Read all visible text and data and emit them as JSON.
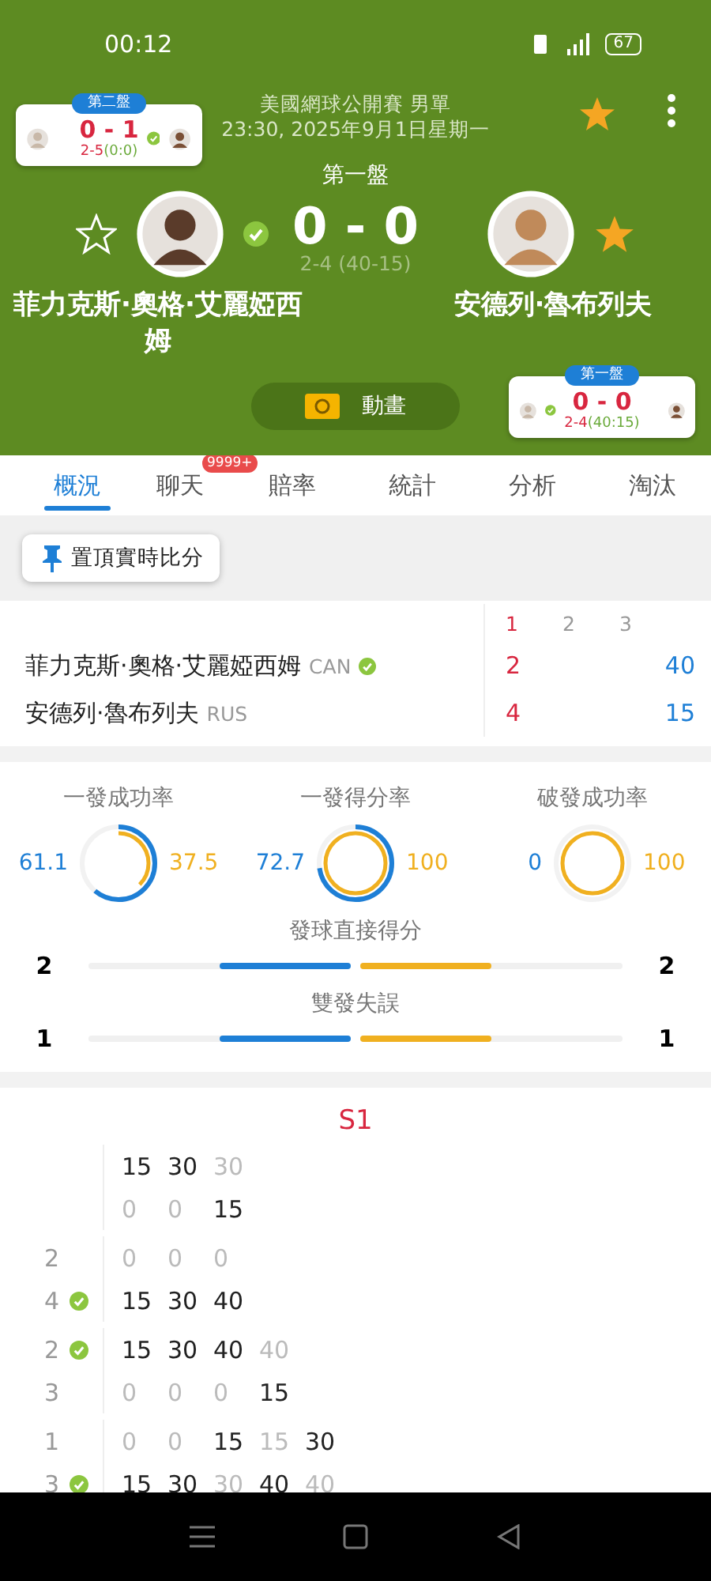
{
  "status_bar": {
    "time": "00:12",
    "battery": "67"
  },
  "header": {
    "title": "美國網球公開賽 男單",
    "datetime": "23:30, 2025年9月1日星期一",
    "favorite": true
  },
  "match": {
    "set_label": "第一盤",
    "score": "0 - 0",
    "sub_score": "2-4 (40-15)",
    "animation_button": "動畫",
    "players": [
      {
        "name": "菲力克斯·奧格·艾麗婭西姆",
        "favorite": false,
        "serving": true
      },
      {
        "name": "安德列·魯布列夫",
        "favorite": true,
        "serving": false
      }
    ]
  },
  "mini_cards": [
    {
      "badge": "第二盤",
      "score": "0 - 1",
      "games": "2-5",
      "points": "(0:0)",
      "left_serving": false,
      "right_serving": true
    },
    {
      "badge": "第一盤",
      "score": "0 - 0",
      "games": "2-4",
      "points": "(40:15)",
      "left_serving": true,
      "right_serving": false
    }
  ],
  "tabs": [
    {
      "label": "概況",
      "selected": true
    },
    {
      "label": "聊天",
      "selected": false,
      "badge": "9999+"
    },
    {
      "label": "賠率",
      "selected": false
    },
    {
      "label": "統計",
      "selected": false
    },
    {
      "label": "分析",
      "selected": false
    },
    {
      "label": "淘汰",
      "selected": false
    }
  ],
  "pin_button": "置頂實時比分",
  "scoreboard": {
    "columns": [
      {
        "label": "1",
        "selected": true
      },
      {
        "label": "2",
        "selected": false
      },
      {
        "label": "3",
        "selected": false
      }
    ],
    "rows": [
      {
        "name": "菲力克斯·奧格·艾麗婭西姆",
        "country": "CAN",
        "serving": true,
        "set_score": "2",
        "points": "40"
      },
      {
        "name": "安德列·魯布列夫",
        "country": "RUS",
        "serving": false,
        "set_score": "4",
        "points": "15"
      }
    ]
  },
  "stats": {
    "rings": [
      {
        "label": "一發成功率",
        "sides": [
          {
            "value": "61.1"
          },
          {
            "value": "37.5"
          }
        ]
      },
      {
        "label": "一發得分率",
        "sides": [
          {
            "value": "72.7"
          },
          {
            "value": "100"
          }
        ]
      },
      {
        "label": "破發成功率",
        "sides": [
          {
            "value": "0"
          },
          {
            "value": "100"
          }
        ]
      }
    ],
    "bars": [
      {
        "label": "發球直接得分",
        "sides": [
          {
            "value": "2",
            "level": 0.5
          },
          {
            "value": "2",
            "level": 0.5
          }
        ]
      },
      {
        "label": "雙發失誤",
        "sides": [
          {
            "value": "1",
            "level": 0.5
          },
          {
            "value": "1",
            "level": 0.5
          }
        ]
      }
    ]
  },
  "point_log": {
    "title": "S1",
    "games": [
      {
        "players": [
          {
            "serving": false,
            "points": [
              {
                "text": "15",
                "strong": true
              },
              {
                "text": "30",
                "strong": true
              },
              {
                "text": "30",
                "strong": false
              }
            ]
          },
          {
            "serving": false,
            "points": [
              {
                "text": "0",
                "strong": false
              },
              {
                "text": "0",
                "strong": false
              },
              {
                "text": "15",
                "strong": true
              }
            ]
          }
        ]
      },
      {
        "players": [
          {
            "games": "2",
            "serving": false,
            "points": [
              {
                "text": "0",
                "strong": false
              },
              {
                "text": "0",
                "strong": false
              },
              {
                "text": "0",
                "strong": false
              }
            ]
          },
          {
            "games": "4",
            "serving": true,
            "points": [
              {
                "text": "15",
                "strong": true
              },
              {
                "text": "30",
                "strong": true
              },
              {
                "text": "40",
                "strong": true
              }
            ]
          }
        ]
      },
      {
        "players": [
          {
            "games": "2",
            "serving": true,
            "points": [
              {
                "text": "15",
                "strong": true
              },
              {
                "text": "30",
                "strong": true
              },
              {
                "text": "40",
                "strong": true
              },
              {
                "text": "40",
                "strong": false
              }
            ]
          },
          {
            "games": "3",
            "serving": false,
            "points": [
              {
                "text": "0",
                "strong": false
              },
              {
                "text": "0",
                "strong": false
              },
              {
                "text": "0",
                "strong": false
              },
              {
                "text": "15",
                "strong": true
              }
            ]
          }
        ]
      },
      {
        "players": [
          {
            "games": "1",
            "serving": false,
            "points": [
              {
                "text": "0",
                "strong": false
              },
              {
                "text": "0",
                "strong": false
              },
              {
                "text": "15",
                "strong": true
              },
              {
                "text": "15",
                "strong": false
              },
              {
                "text": "30",
                "strong": true
              }
            ]
          },
          {
            "games": "3",
            "serving": true,
            "points": [
              {
                "text": "15",
                "strong": true
              },
              {
                "text": "30",
                "strong": true
              },
              {
                "text": "30",
                "strong": false
              },
              {
                "text": "40",
                "strong": true
              },
              {
                "text": "40",
                "strong": false
              }
            ]
          }
        ]
      }
    ]
  }
}
